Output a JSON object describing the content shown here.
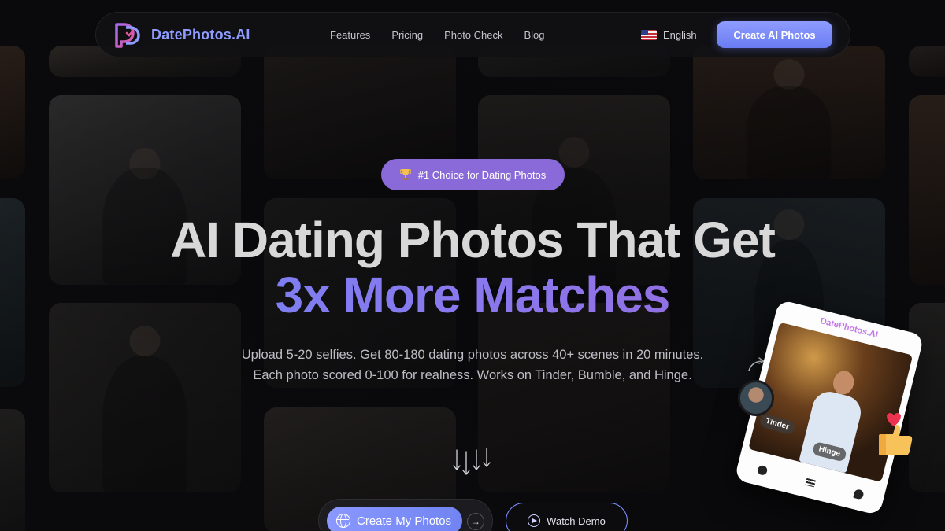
{
  "nav": {
    "brand": "DatePhotos.AI",
    "links": [
      "Features",
      "Pricing",
      "Photo Check",
      "Blog"
    ],
    "language": "English",
    "cta": "Create AI Photos"
  },
  "hero": {
    "badge": "#1 Choice for Dating Photos",
    "badge_icon": "trophy-icon",
    "title_line1": "AI Dating Photos That Get",
    "title_line2": "3x More Matches",
    "subtitle_line1": "Upload 5-20 selfies. Get 80-180 dating photos across 40+ scenes in 20 minutes.",
    "subtitle_line2": "Each photo scored 0-100 for realness. Works on Tinder, Bumble, and Hinge.",
    "primary_cta": "Create My Photos",
    "secondary_cta": "Watch Demo"
  },
  "phone": {
    "title": "DatePhotos.AI",
    "tags": [
      "Tinder",
      "Hinge"
    ]
  },
  "colors": {
    "accent": "#7f8ffb",
    "accent_gradient_end": "#9a66d6",
    "badge_bg": "#8a6ad8",
    "background": "#0b0b0d"
  }
}
